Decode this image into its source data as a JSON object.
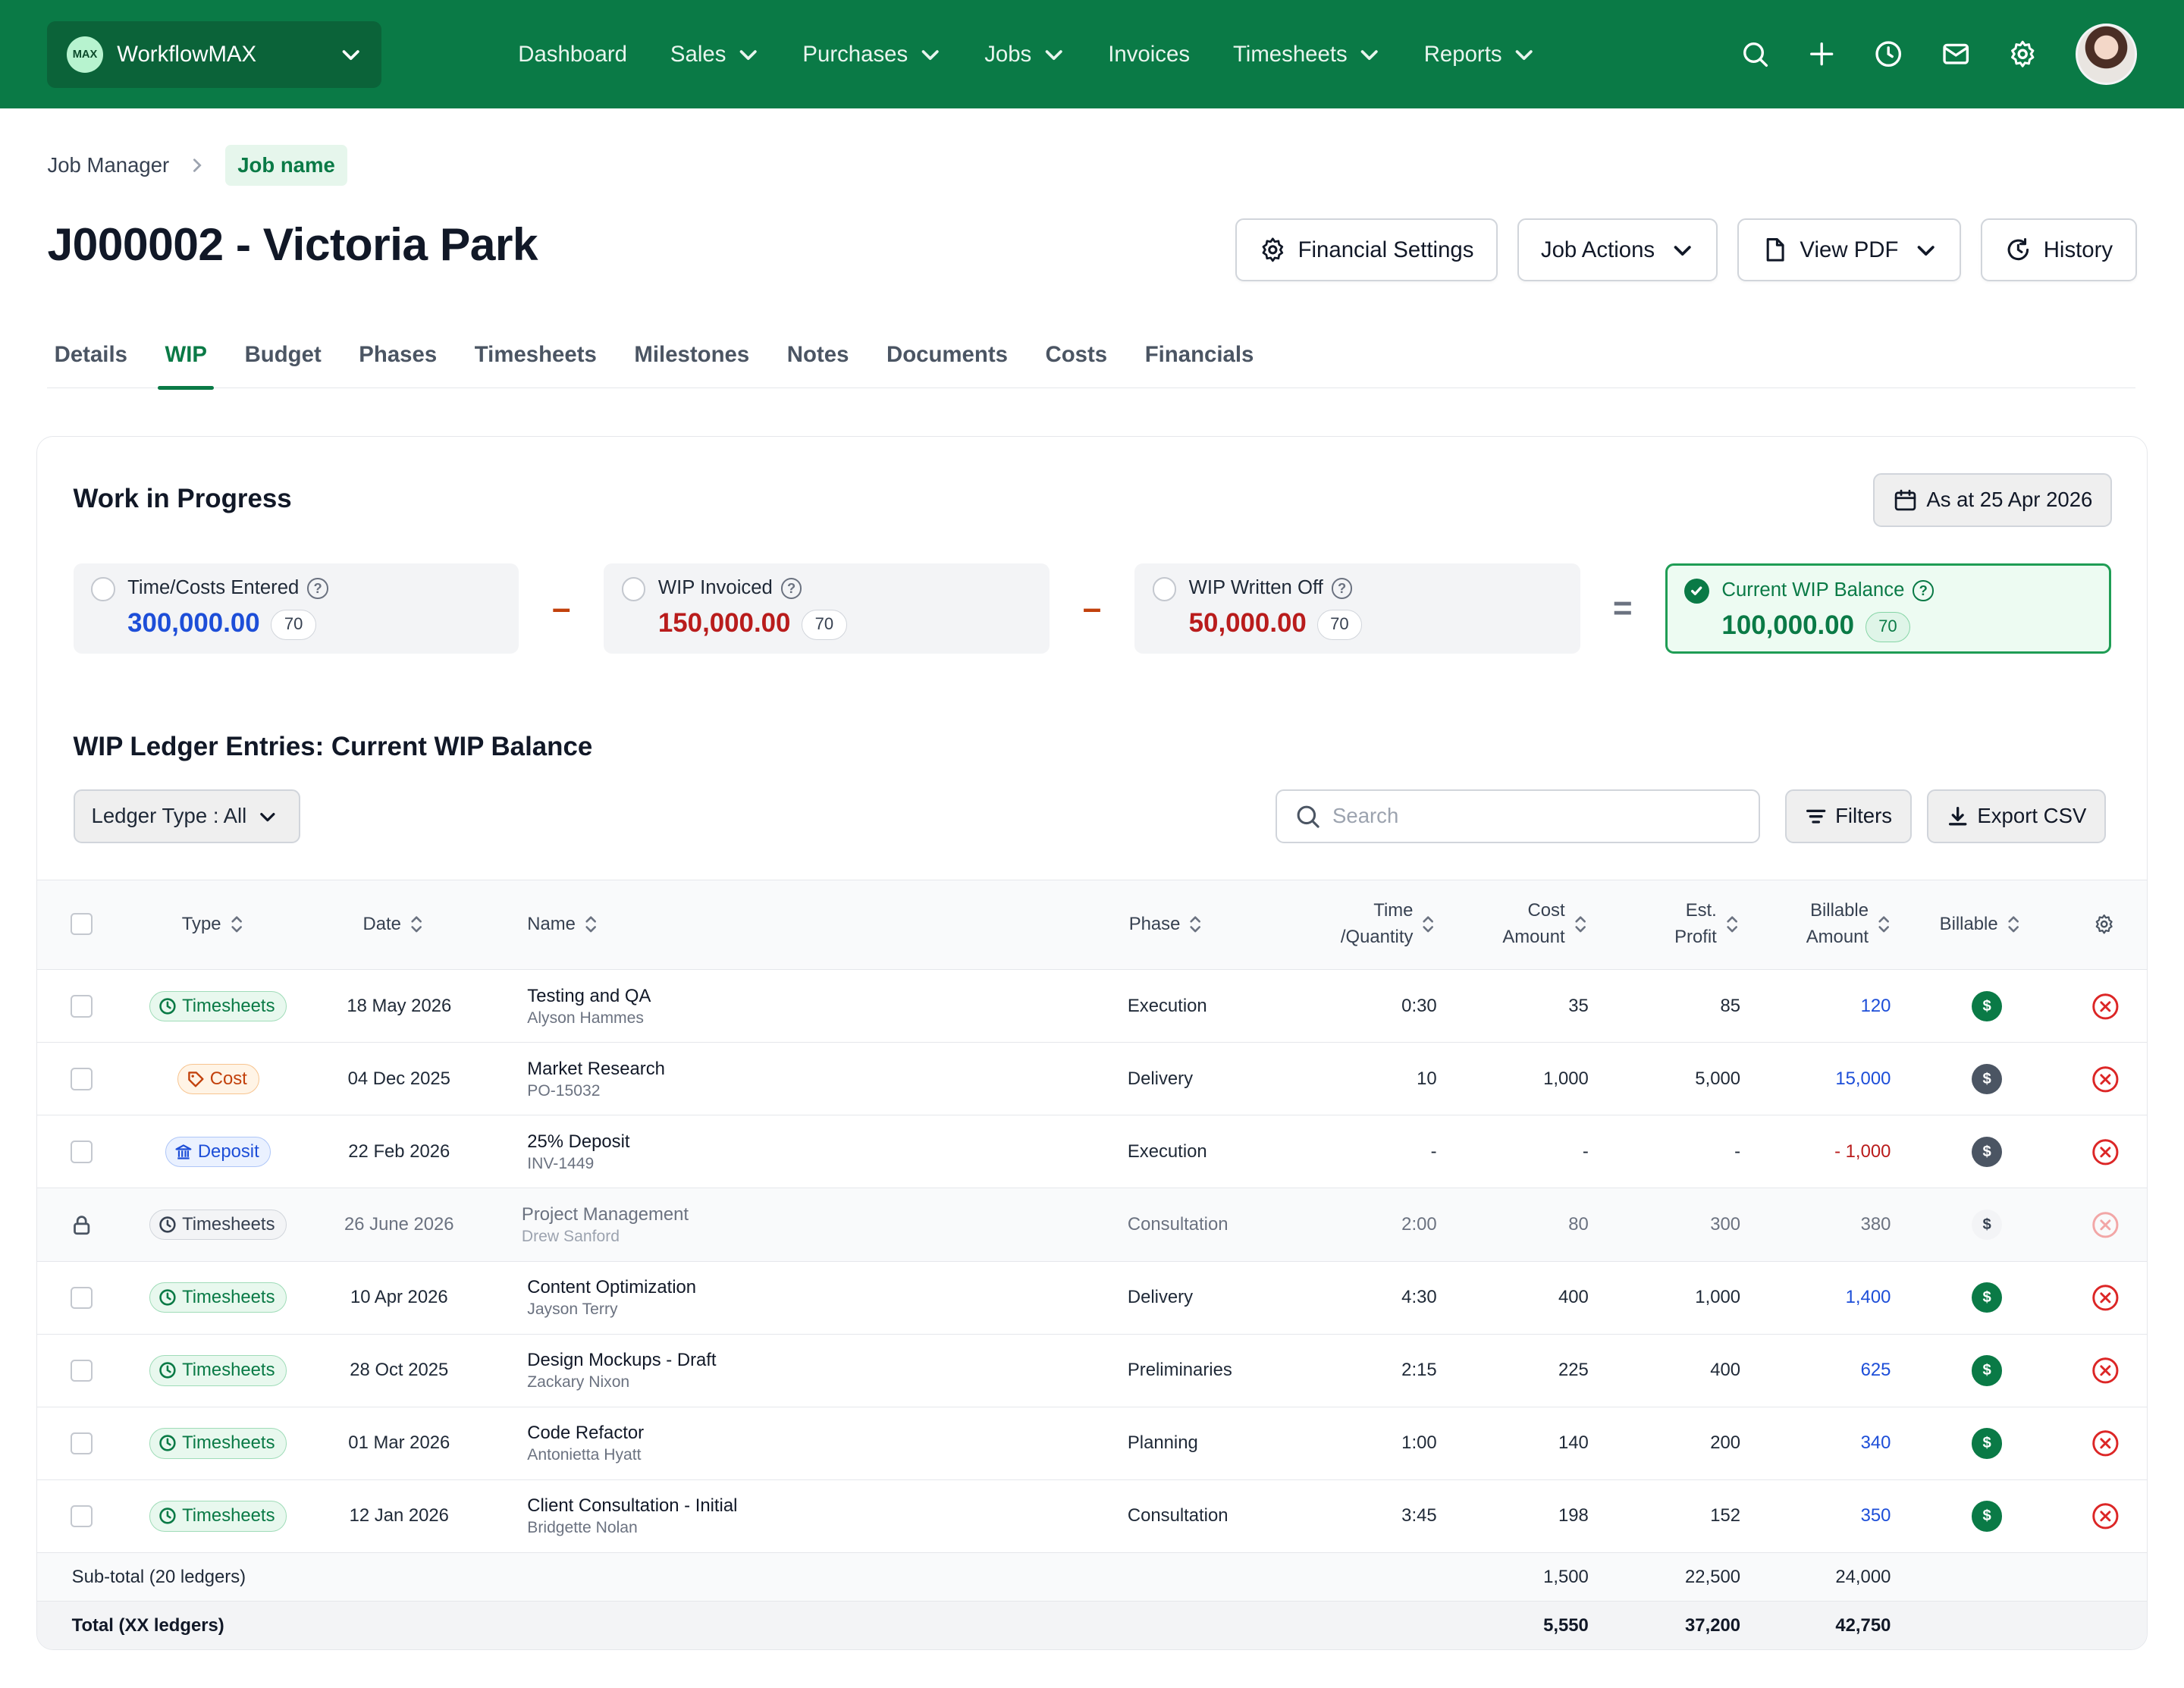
{
  "app": {
    "org_name": "WorkflowMAX",
    "logo_text": "MAX"
  },
  "nav": {
    "links": [
      {
        "label": "Dashboard",
        "has_menu": false
      },
      {
        "label": "Sales",
        "has_menu": true
      },
      {
        "label": "Purchases",
        "has_menu": true
      },
      {
        "label": "Jobs",
        "has_menu": true
      },
      {
        "label": "Invoices",
        "has_menu": false
      },
      {
        "label": "Timesheets",
        "has_menu": true
      },
      {
        "label": "Reports",
        "has_menu": true
      }
    ],
    "icons": [
      "search-icon",
      "plus-icon",
      "clock-icon",
      "mail-icon",
      "gear-icon"
    ]
  },
  "breadcrumb": {
    "parent": "Job Manager",
    "current": "Job name"
  },
  "page": {
    "title": "J000002 - Victoria Park"
  },
  "header_actions": {
    "financial_settings": "Financial Settings",
    "job_actions": "Job Actions",
    "view_pdf": "View PDF",
    "history": "History"
  },
  "tabs": [
    "Details",
    "WIP",
    "Budget",
    "Phases",
    "Timesheets",
    "Milestones",
    "Notes",
    "Documents",
    "Costs",
    "Financials"
  ],
  "active_tab": "WIP",
  "wip": {
    "title": "Work in Progress",
    "as_at": "As at 25 Apr 2026",
    "summary": [
      {
        "label": "Time/Costs Entered",
        "amount": "300,000.00",
        "count": "70",
        "color": "#1d4ed8"
      },
      {
        "label": "WIP Invoiced",
        "amount": "150,000.00",
        "count": "70",
        "color": "#b91c1c"
      },
      {
        "label": "WIP Written Off",
        "amount": "50,000.00",
        "count": "70",
        "color": "#b91c1c"
      },
      {
        "label": "Current WIP Balance",
        "amount": "100,000.00",
        "count": "70",
        "color": "#0a7a46"
      }
    ],
    "operators": [
      "–",
      "–",
      "="
    ]
  },
  "ledger": {
    "title": "WIP Ledger Entries: Current WIP Balance",
    "type_filter": "Ledger Type : All",
    "search_placeholder": "Search",
    "filters_label": "Filters",
    "export_label": "Export CSV",
    "columns": {
      "type": "Type",
      "date": "Date",
      "name": "Name",
      "phase": "Phase",
      "time_qty_1": "Time",
      "time_qty_2": "/Quantity",
      "cost_1": "Cost",
      "cost_2": "Amount",
      "profit_1": "Est.",
      "profit_2": "Profit",
      "billable_amt_1": "Billable",
      "billable_amt_2": "Amount",
      "billable": "Billable"
    },
    "rows": [
      {
        "type": "Timesheets",
        "kind": "ts",
        "date": "18 May 2026",
        "name": "Testing and QA",
        "sub": "Alyson Hammes",
        "phase": "Execution",
        "time": "0:30",
        "cost": "35",
        "profit": "85",
        "billable_amount": "120",
        "amount_style": "blue",
        "billable": "on",
        "locked": false
      },
      {
        "type": "Cost",
        "kind": "cost",
        "date": "04 Dec 2025",
        "name": "Market Research",
        "sub": "PO-15032",
        "phase": "Delivery",
        "time": "10",
        "cost": "1,000",
        "profit": "5,000",
        "billable_amount": "15,000",
        "amount_style": "blue",
        "billable": "off",
        "locked": false
      },
      {
        "type": "Deposit",
        "kind": "dep",
        "date": "22 Feb 2026",
        "name": "25% Deposit",
        "sub": "INV-1449",
        "phase": "Execution",
        "time": "-",
        "cost": "-",
        "profit": "-",
        "billable_amount": "- 1,000",
        "amount_style": "red",
        "billable": "off",
        "locked": false
      },
      {
        "type": "Timesheets",
        "kind": "lock",
        "date": "26 June 2026",
        "name": "Project Management",
        "sub": "Drew Sanford",
        "phase": "Consultation",
        "time": "2:00",
        "cost": "80",
        "profit": "300",
        "billable_amount": "380",
        "amount_style": "plain",
        "billable": "ghost",
        "locked": true
      },
      {
        "type": "Timesheets",
        "kind": "ts",
        "date": "10 Apr 2026",
        "name": "Content Optimization",
        "sub": "Jayson Terry",
        "phase": "Delivery",
        "time": "4:30",
        "cost": "400",
        "profit": "1,000",
        "billable_amount": "1,400",
        "amount_style": "blue",
        "billable": "on",
        "locked": false
      },
      {
        "type": "Timesheets",
        "kind": "ts",
        "date": "28 Oct 2025",
        "name": "Design Mockups - Draft",
        "sub": "Zackary Nixon",
        "phase": "Preliminaries",
        "time": "2:15",
        "cost": "225",
        "profit": "400",
        "billable_amount": "625",
        "amount_style": "blue",
        "billable": "on",
        "locked": false
      },
      {
        "type": "Timesheets",
        "kind": "ts",
        "date": "01 Mar 2026",
        "name": "Code Refactor",
        "sub": "Antonietta Hyatt",
        "phase": "Planning",
        "time": "1:00",
        "cost": "140",
        "profit": "200",
        "billable_amount": "340",
        "amount_style": "blue",
        "billable": "on",
        "locked": false
      },
      {
        "type": "Timesheets",
        "kind": "ts",
        "date": "12 Jan 2026",
        "name": "Client Consultation - Initial",
        "sub": "Bridgette Nolan",
        "phase": "Consultation",
        "time": "3:45",
        "cost": "198",
        "profit": "152",
        "billable_amount": "350",
        "amount_style": "blue",
        "billable": "on",
        "locked": false
      }
    ],
    "subtotal": {
      "label": "Sub-total (20 ledgers)",
      "cost": "1,500",
      "profit": "22,500",
      "billable_amount": "24,000"
    },
    "total": {
      "label": "Total (XX ledgers)",
      "cost": "5,550",
      "profit": "37,200",
      "billable_amount": "42,750"
    }
  },
  "colors": {
    "brand": "#0a7a46",
    "link_blue": "#1d4ed8",
    "negative_red": "#b91c1c",
    "remove_red": "#dc2626"
  }
}
